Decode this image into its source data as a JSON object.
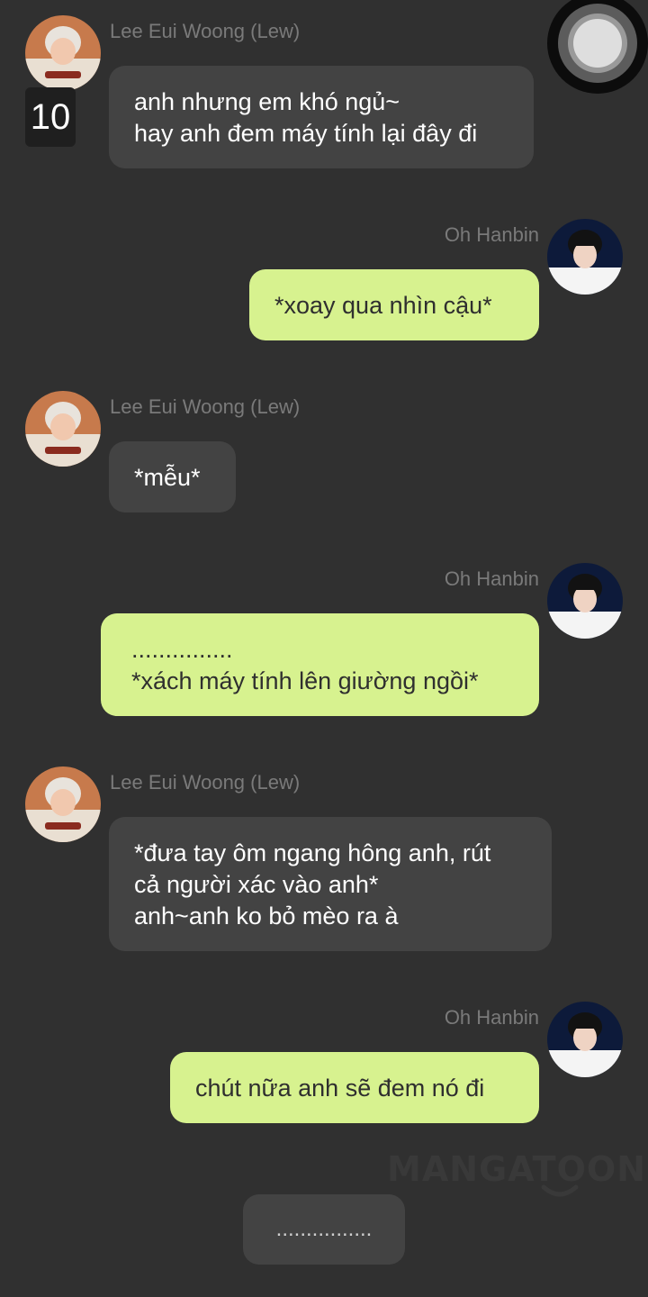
{
  "participants": {
    "lew": {
      "name": "Lee Eui Woong (Lew)"
    },
    "hanbin": {
      "name": "Oh Hanbin"
    }
  },
  "episode_badge": "10",
  "messages": [
    {
      "sender": "Lee Eui Woong (Lew)",
      "side": "left",
      "text": "anh nhưng em khó ngủ~\nhay anh đem máy tính lại đây đi"
    },
    {
      "sender": "Oh Hanbin",
      "side": "right",
      "text": "*xoay qua nhìn cậu*"
    },
    {
      "sender": "Lee Eui Woong (Lew)",
      "side": "left",
      "text": "*mễu*"
    },
    {
      "sender": "Oh Hanbin",
      "side": "right",
      "text": "...............\n*xách máy tính lên giường ngồi*"
    },
    {
      "sender": "Lee Eui Woong (Lew)",
      "side": "left",
      "text": "*đưa tay ôm ngang hông anh, rút\ncả người xác vào anh*\nanh~anh ko bỏ mèo ra à"
    },
    {
      "sender": "Oh Hanbin",
      "side": "right",
      "text": "chút nữa anh sẽ đem nó đi"
    }
  ],
  "typing_bubble": "................",
  "watermark": "MANGATOON",
  "colors": {
    "background": "#303030",
    "left_bubble": "#434343",
    "right_bubble": "#d7f28f",
    "sender_name": "#7a7a7a"
  },
  "icons": {
    "record_button": "record-button-icon",
    "avatar_lew": "avatar-photo",
    "avatar_hanbin": "avatar-photo"
  }
}
